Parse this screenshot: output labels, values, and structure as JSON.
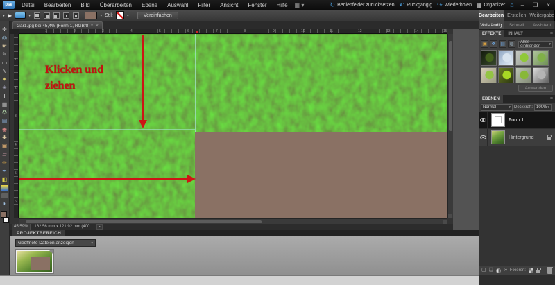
{
  "window": {
    "logo": "pse",
    "controls": {
      "minimize": "–",
      "restore": "❐",
      "close": "×"
    }
  },
  "menu": {
    "items": [
      "Datei",
      "Bearbeiten",
      "Bild",
      "Überarbeiten",
      "Ebene",
      "Auswahl",
      "Filter",
      "Ansicht",
      "Fenster",
      "Hilfe"
    ]
  },
  "quick_actions": {
    "reset": "Bedienfelder zurücksetzen",
    "undo": "Rückgängig",
    "redo": "Wiederholen",
    "organizer": "Organizer"
  },
  "options_bar": {
    "style_label": "Stil:",
    "simplify": "Vereinfachen"
  },
  "toolbar": {
    "tools": [
      {
        "name": "move-tool",
        "glyph": "✛",
        "color": "#d0d0d0"
      },
      {
        "name": "zoom-tool",
        "glyph": "◎",
        "color": "#9ec4e0"
      },
      {
        "name": "hand-tool",
        "glyph": "☛",
        "color": "#c8b896"
      },
      {
        "name": "eyedropper-tool",
        "glyph": "✎",
        "color": "#b0b0b0"
      },
      {
        "name": "marquee-tool",
        "glyph": "▭",
        "color": "#c8c8c8"
      },
      {
        "name": "lasso-tool",
        "glyph": "∿",
        "color": "#c8c8c8"
      },
      {
        "name": "magic-wand-tool",
        "glyph": "✦",
        "color": "#d8c870"
      },
      {
        "name": "selection-brush-tool",
        "glyph": "✳",
        "color": "#b8b8d0"
      },
      {
        "name": "type-tool",
        "glyph": "T",
        "color": "#d8d8d8"
      },
      {
        "name": "crop-tool",
        "glyph": "▦",
        "color": "#b8b8b8"
      },
      {
        "name": "cookie-cutter-tool",
        "glyph": "✪",
        "color": "#a8c8a0"
      },
      {
        "name": "straighten-tool",
        "glyph": "▤",
        "color": "#88a8d0"
      },
      {
        "name": "red-eye-tool",
        "glyph": "◉",
        "color": "#d08080"
      },
      {
        "name": "healing-brush-tool",
        "glyph": "✚",
        "color": "#d8c8a0"
      },
      {
        "name": "clone-stamp-tool",
        "glyph": "▣",
        "color": "#c09868"
      },
      {
        "name": "eraser-tool",
        "glyph": "▱",
        "color": "#e0a8b8"
      },
      {
        "name": "brush-tool",
        "glyph": "✏",
        "color": "#d0a048"
      },
      {
        "name": "smart-brush-tool",
        "glyph": "✒",
        "color": "#88b0e0"
      },
      {
        "name": "paint-bucket-tool",
        "glyph": "◧",
        "color": "#d8d048"
      },
      {
        "name": "gradient-tool",
        "style": "gradient"
      },
      {
        "name": "shape-tool",
        "style": "shape",
        "active": true
      },
      {
        "name": "blur-tool",
        "glyph": "◗",
        "color": "#a0c0e0"
      }
    ]
  },
  "document": {
    "tab": "Gar1.jpg bei 45,4% (Form 1, RGB/8) *",
    "status_zoom": "45,59%",
    "status_info": "162,56 mm x 121,92 mm (400...",
    "annotation_line1": "Klicken und",
    "annotation_line2": "ziehen",
    "ruler_h": [
      "1",
      "2",
      "3",
      "4",
      "5",
      "6",
      "7",
      "8",
      "9",
      "10",
      "11",
      "12",
      "13",
      "14",
      "15"
    ],
    "ruler_v": [
      "1",
      "2",
      "3",
      "4",
      "5",
      "6"
    ]
  },
  "colors": {
    "accent_blue": "#4aa0e0",
    "annotation_red": "#ce1515",
    "shape_brown": "#8a7164",
    "guide_cyan": "#a0e0c4",
    "grass_green": "#4f7f2c"
  },
  "right_panel": {
    "tabs": [
      {
        "label": "Bearbeiten",
        "active": true
      },
      {
        "label": "Erstellen",
        "active": false
      },
      {
        "label": "Weitergabe",
        "active": false
      }
    ],
    "mode_tabs": [
      {
        "label": "Vollständig",
        "active": true
      },
      {
        "label": "Schnell",
        "active": false
      },
      {
        "label": "Assistent",
        "active": false
      }
    ],
    "effects": {
      "tab_effects": "EFFEKTE",
      "tab_content": "INHALT",
      "filter": "Alles einblenden",
      "apply": "Anwenden",
      "thumbs": [
        {
          "apple": "#44601c",
          "bg1": "#141c0c",
          "bg2": "#38482c"
        },
        {
          "apple": "#d8e4ee",
          "bg1": "#90a8c4",
          "bg2": "#e8f0f8"
        },
        {
          "apple": "#90c838",
          "bg1": "#c4c8c0",
          "bg2": "#989e94"
        },
        {
          "apple": "#80b048",
          "bg1": "#b0c49c",
          "bg2": "#6e9054"
        },
        {
          "apple": "#94c444",
          "bg1": "#d4ccb4",
          "bg2": "#9c9c84"
        },
        {
          "apple": "#a8d824",
          "bg1": "#6c7c24",
          "bg2": "#2c3810"
        },
        {
          "apple": "#88b838",
          "bg1": "#bcc4b4",
          "bg2": "#848c78"
        },
        {
          "apple": "#b4b4b4",
          "bg1": "#dcdcdc",
          "bg2": "#646464"
        }
      ]
    },
    "layers": {
      "title": "EBENEN",
      "blend_mode": "Normal",
      "opacity_label": "Deckkraft:",
      "opacity": "100%",
      "items": [
        {
          "name": "Form 1",
          "selected": true
        },
        {
          "name": "Hintergrund",
          "locked": true
        }
      ],
      "lock_label": "Fixieren:"
    }
  },
  "project_bin": {
    "tab": "PROJEKTBEREICH",
    "filter": "Geöffnete Dateien anzeigen"
  }
}
